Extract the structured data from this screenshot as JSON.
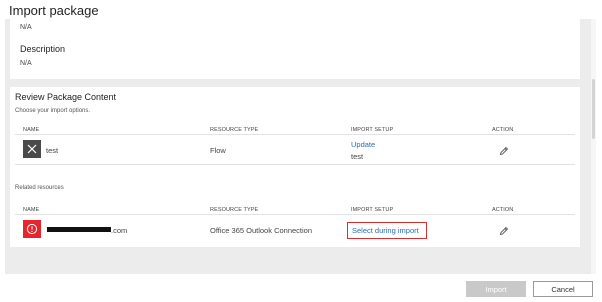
{
  "window": {
    "title": "Import package"
  },
  "details": {
    "value1": "N/A",
    "description_label": "Description",
    "description_value": "N/A"
  },
  "review": {
    "heading": "Review Package Content",
    "subheading": "Choose your import options.",
    "columns": {
      "name": "NAME",
      "resource_type": "RESOURCE TYPE",
      "import_setup": "IMPORT SETUP",
      "action": "ACTION"
    },
    "rows": [
      {
        "name": "test",
        "resource_type": "Flow",
        "setup_link": "Update",
        "setup_value": "test",
        "icon": "close-x-icon"
      }
    ]
  },
  "related": {
    "label": "Related resources",
    "columns": {
      "name": "NAME",
      "resource_type": "RESOURCE TYPE",
      "import_setup": "IMPORT SETUP",
      "action": "ACTION"
    },
    "rows": [
      {
        "name_suffix": ".com",
        "resource_type": "Office 365 Outlook Connection",
        "setup_link": "Select during import",
        "icon": "warning-icon"
      }
    ]
  },
  "footer": {
    "import_label": "Import",
    "cancel_label": "Cancel"
  },
  "colors": {
    "link": "#2b6cb0",
    "danger": "#e6252f",
    "highlight_border": "#d32f2f"
  }
}
